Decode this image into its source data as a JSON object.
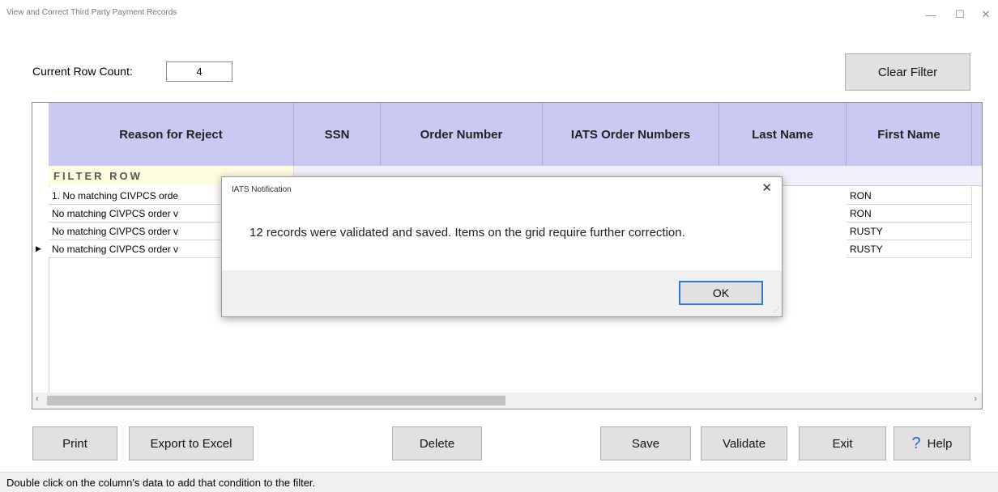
{
  "window": {
    "title": "View and Correct Third Party Payment Records",
    "minimize_glyph": "—",
    "maximize_glyph": "☐",
    "close_glyph": "✕"
  },
  "row_count": {
    "label": "Current Row Count:",
    "value": "4"
  },
  "buttons": {
    "clear_filter": "Clear Filter",
    "print": "Print",
    "export": "Export to Excel",
    "delete": "Delete",
    "save": "Save",
    "validate": "Validate",
    "exit": "Exit",
    "help": "Help",
    "help_glyph": "?"
  },
  "grid": {
    "columns": [
      "Reason for Reject",
      "SSN",
      "Order Number",
      "IATS Order Numbers",
      "Last Name",
      "First Name"
    ],
    "filter_label": "FILTER ROW",
    "rows": [
      {
        "reason": "1. No matching CIVPCS orde",
        "first_name": "RON"
      },
      {
        "reason": "No matching CIVPCS order v",
        "first_name": "RON"
      },
      {
        "reason": "No matching CIVPCS order v",
        "first_name": "RUSTY"
      },
      {
        "reason": "No matching CIVPCS order v",
        "first_name": "RUSTY"
      }
    ],
    "current_row_glyph": "▶",
    "scroll_left_glyph": "‹",
    "scroll_right_glyph": "›"
  },
  "status": "Double click on the column's data to add that condition to the filter.",
  "dialog": {
    "title": "IATS Notification",
    "close_glyph": "✕",
    "message": "12 records were validated and saved. Items on the grid require further correction.",
    "ok": "OK"
  }
}
